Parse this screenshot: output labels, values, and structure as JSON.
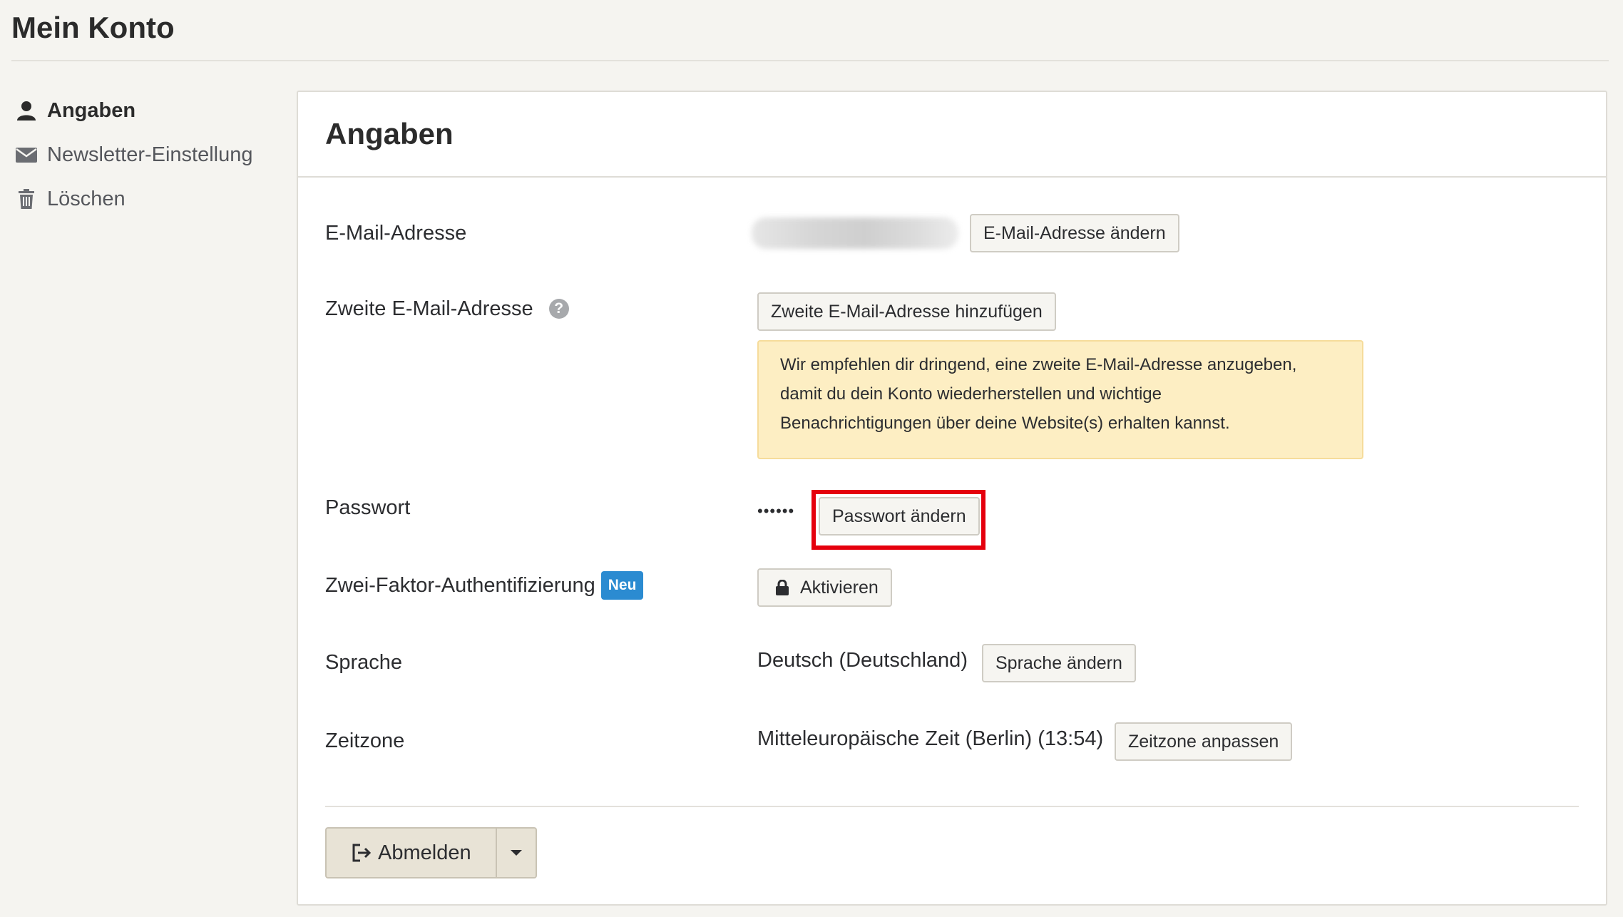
{
  "page": {
    "title": "Mein Konto"
  },
  "sidebar": {
    "items": [
      {
        "label": "Angaben",
        "icon": "user-icon",
        "active": true
      },
      {
        "label": "Newsletter-Einstellung",
        "icon": "envelope-icon",
        "active": false
      },
      {
        "label": "Löschen",
        "icon": "trash-icon",
        "active": false
      }
    ]
  },
  "card": {
    "title": "Angaben",
    "email": {
      "label": "E-Mail-Adresse",
      "change_button": "E-Mail-Adresse ändern"
    },
    "second_email": {
      "label": "Zweite E-Mail-Adresse",
      "help_icon": "question-icon",
      "help_glyph": "?",
      "add_button": "Zweite E-Mail-Adresse hinzufügen",
      "alert_lines": [
        "Wir empfehlen dir dringend, eine zweite E-Mail-Adresse anzugeben,",
        "damit du dein Konto wiederherstellen und wichtige",
        "Benachrichtigungen über deine Website(s) erhalten kannst."
      ]
    },
    "password": {
      "label": "Passwort",
      "masked_value": "••••••",
      "change_button": "Passwort ändern"
    },
    "two_factor": {
      "label": "Zwei-Faktor-Authentifizierung",
      "badge": "Neu",
      "activate_button": "Aktivieren",
      "icon": "lock-icon"
    },
    "language": {
      "label": "Sprache",
      "value": "Deutsch (Deutschland)",
      "change_button": "Sprache ändern"
    },
    "timezone": {
      "label": "Zeitzone",
      "value": "Mitteleuropäische Zeit (Berlin) (13:54)",
      "change_button": "Zeitzone anpassen"
    },
    "logout": {
      "label": "Abmelden",
      "icon": "sign-out-icon",
      "dropdown_icon": "caret-down-icon"
    }
  },
  "colors": {
    "background": "#f5f4f0",
    "card": "#ffffff",
    "alert_bg": "#fdeec3",
    "badge": "#2b8bd1",
    "highlight": "#e5000d"
  }
}
